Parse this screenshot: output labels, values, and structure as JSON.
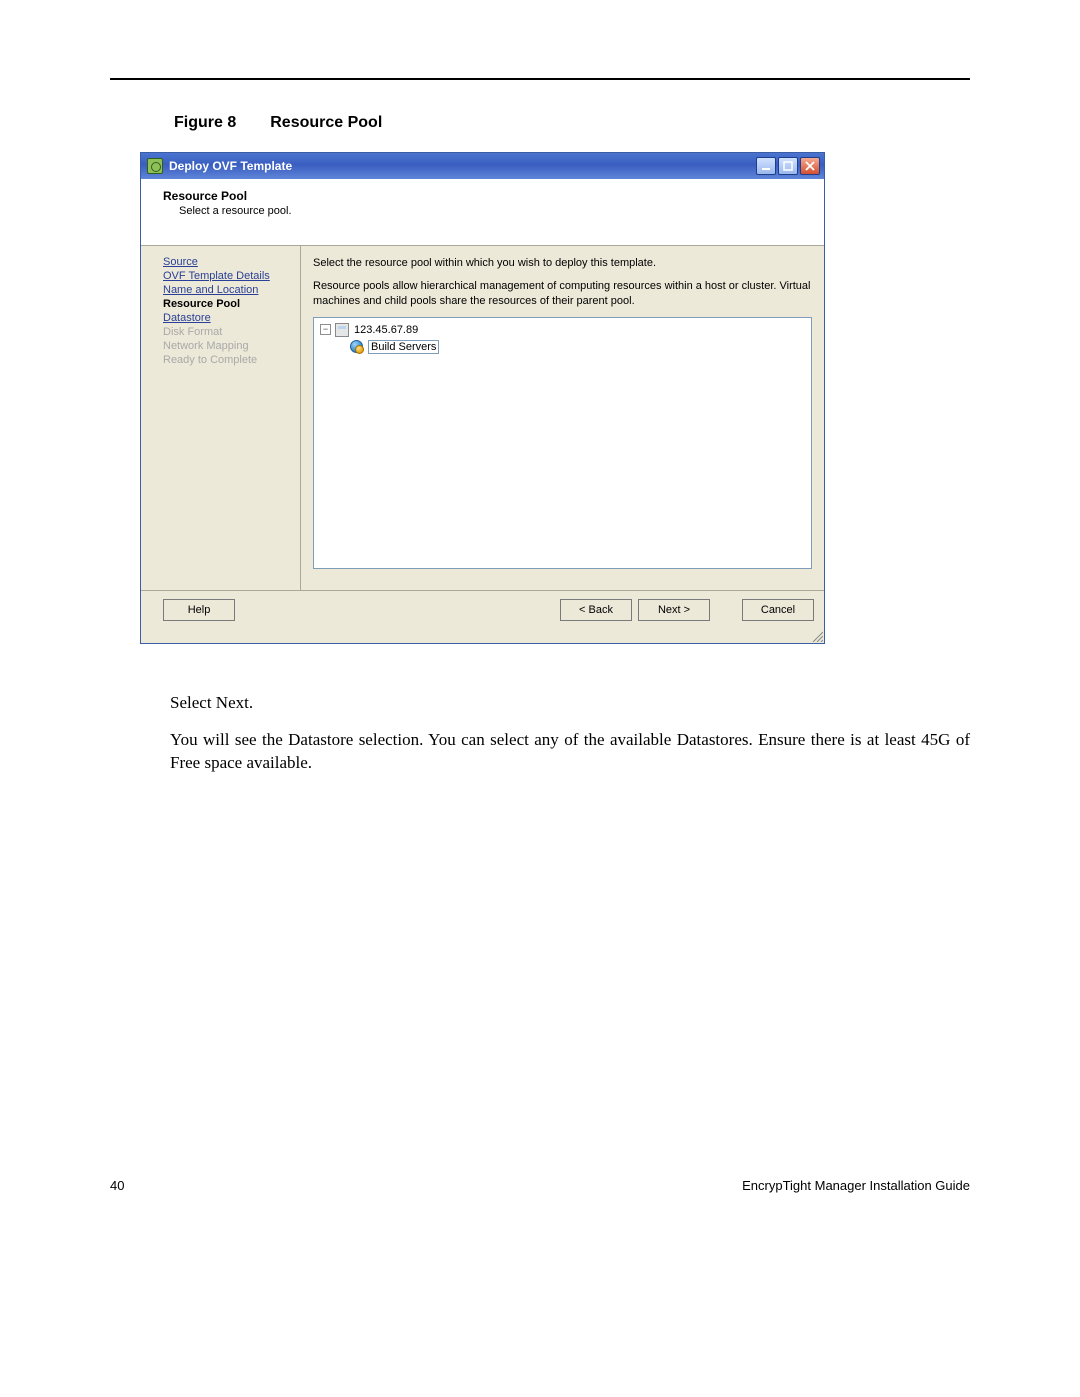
{
  "caption": {
    "label": "Figure 8",
    "title": "Resource Pool"
  },
  "window": {
    "title": "Deploy OVF Template",
    "header_title": "Resource Pool",
    "header_subtitle": "Select a resource pool.",
    "nav": {
      "completed": [
        "Source",
        "OVF Template Details",
        "Name and Location"
      ],
      "current": "Resource Pool",
      "after_link": "Datastore",
      "disabled": [
        "Disk Format",
        "Network Mapping",
        "Ready to Complete"
      ]
    },
    "instructions": {
      "line1": "Select the resource pool within which you wish to deploy this template.",
      "line2": "Resource pools allow hierarchical management of computing resources within a host or cluster. Virtual machines and child pools share the resources of their parent pool."
    },
    "tree": {
      "host": "123.45.67.89",
      "pool": "Build Servers"
    },
    "buttons": {
      "help": "Help",
      "back": "< Back",
      "next": "Next >",
      "cancel": "Cancel"
    }
  },
  "doc": {
    "p1": "Select Next.",
    "p2": "You will see the Datastore selection. You can select any of the available Datastores. Ensure there is at least 45G of Free space available."
  },
  "footer": {
    "page": "40",
    "guide": "EncrypTight Manager Installation Guide"
  }
}
